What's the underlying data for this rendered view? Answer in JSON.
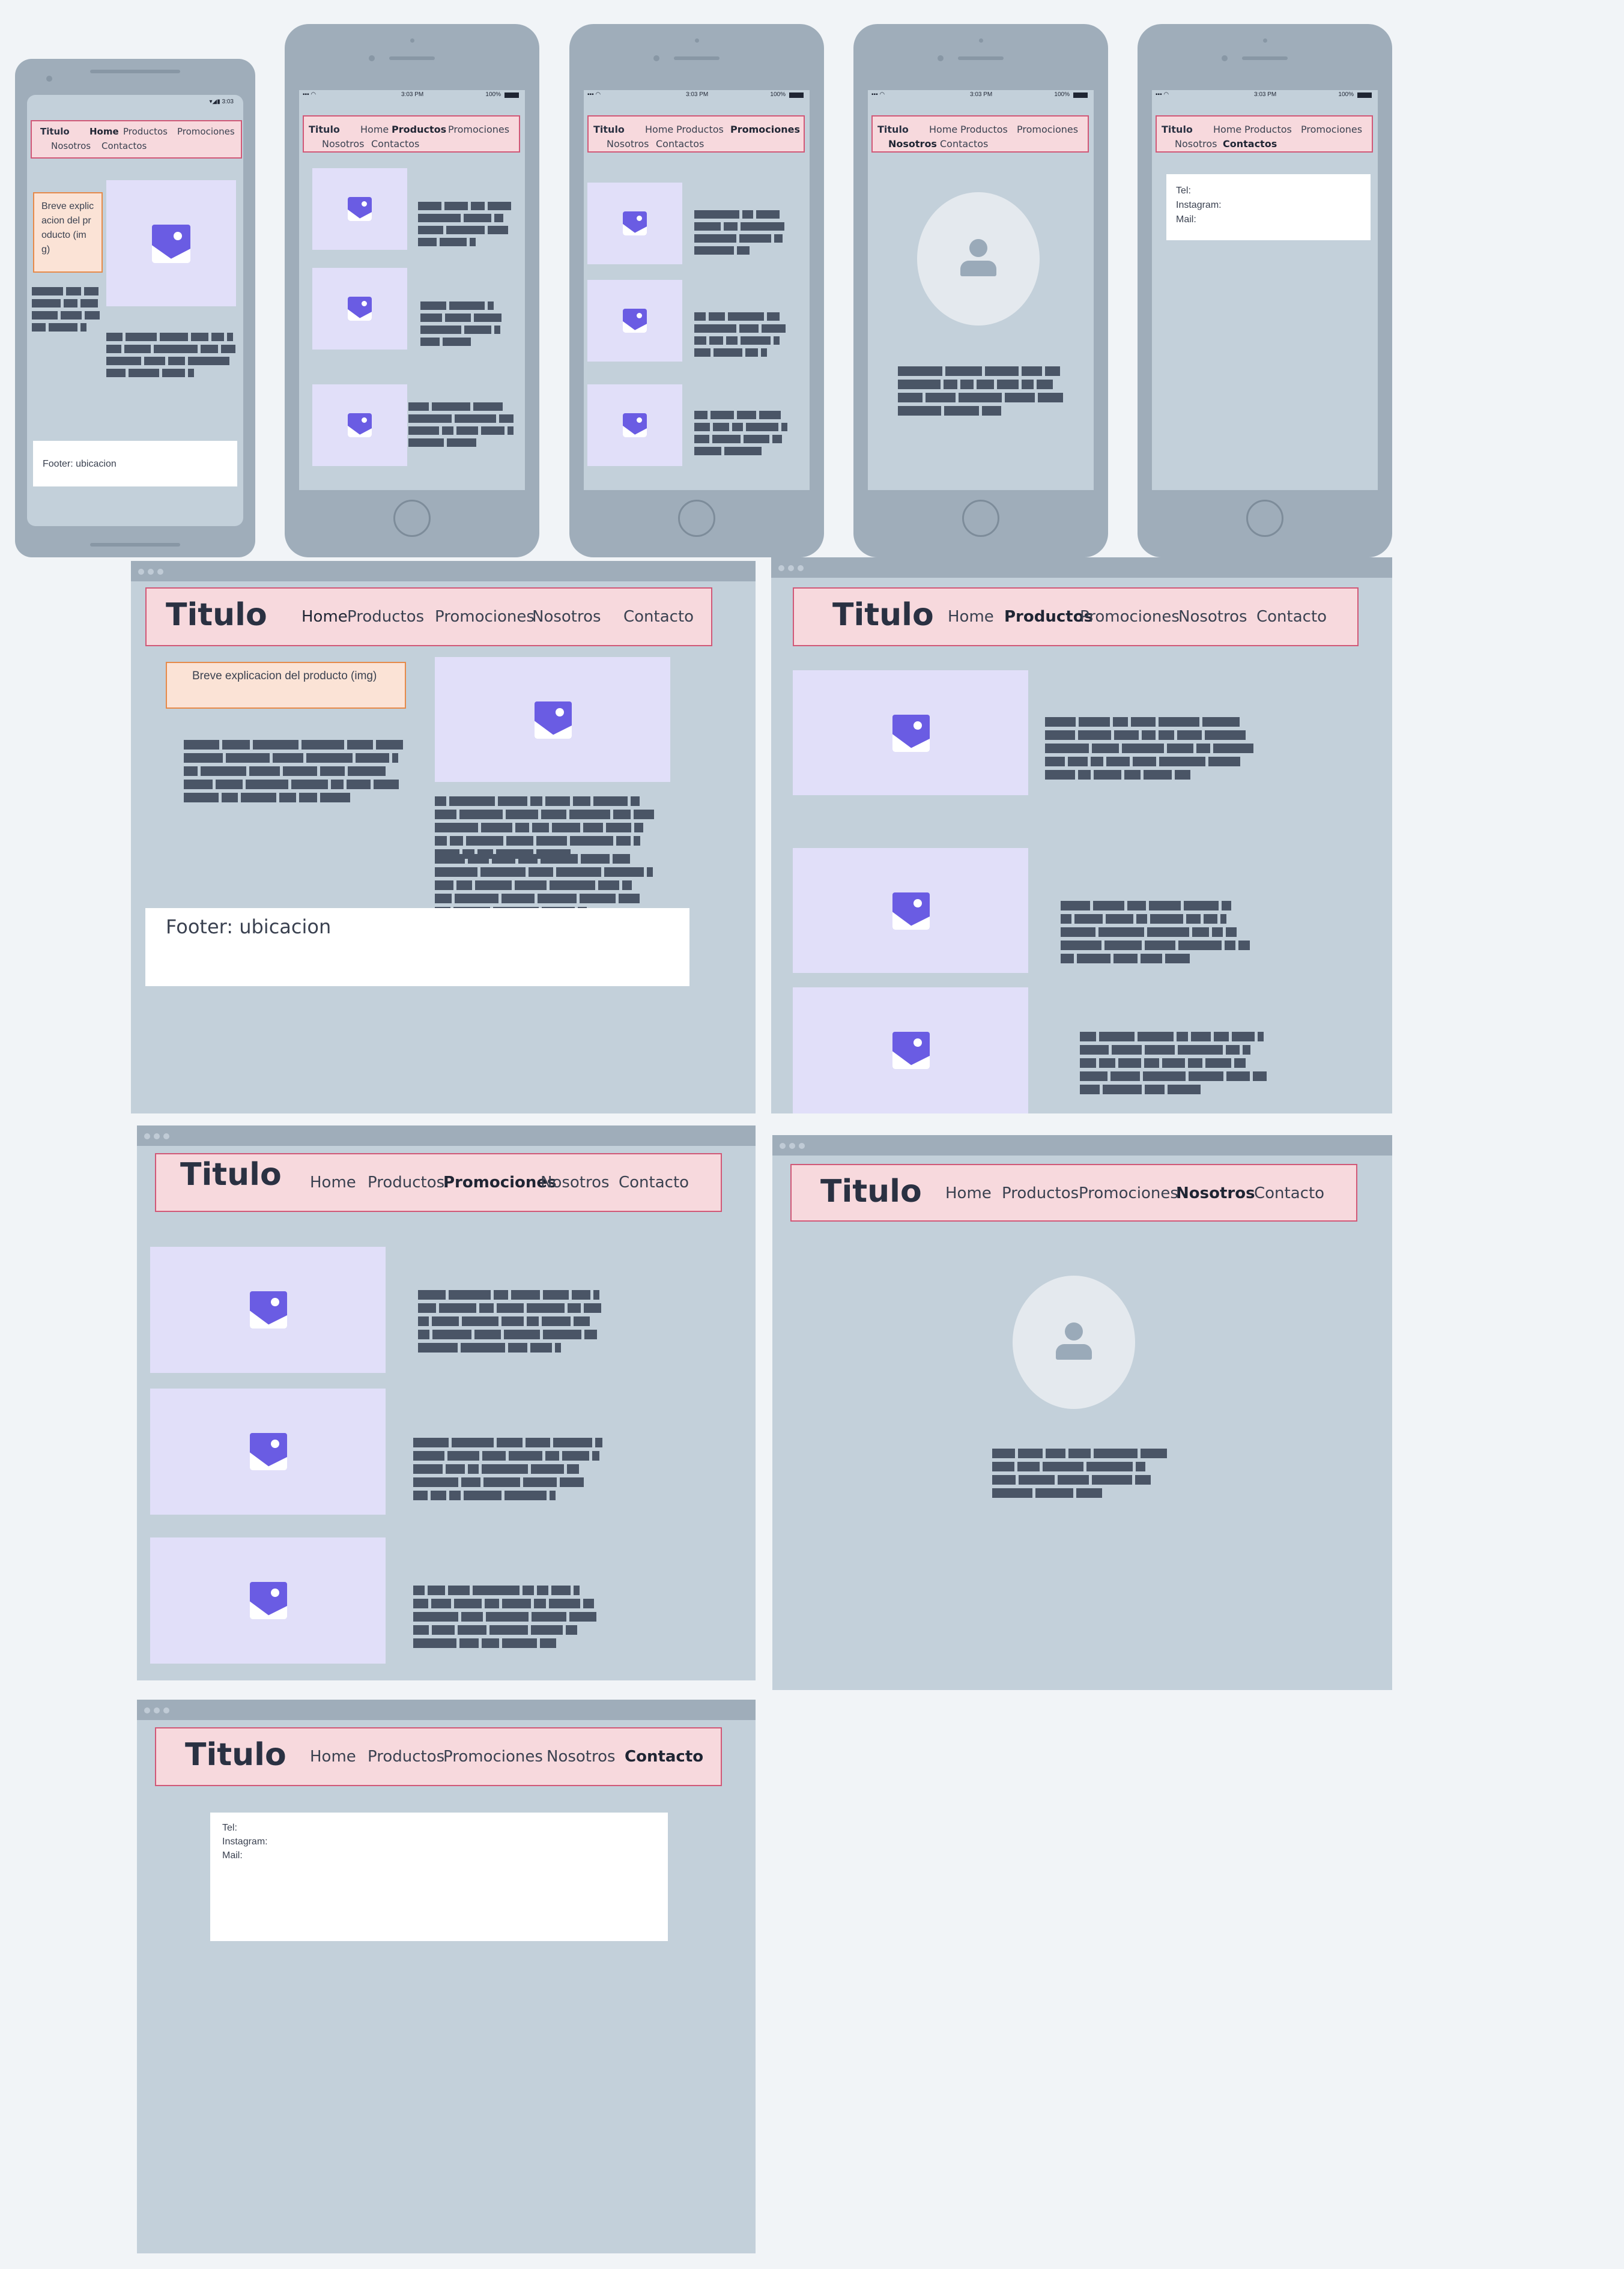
{
  "nav": {
    "title": "Titulo",
    "home": "Home",
    "productos": "Productos",
    "promociones": "Promociones",
    "nosotros": "Nosotros",
    "contacto": "Contacto",
    "contactos": "Contactos"
  },
  "status": {
    "android_time": "3:03",
    "ios_time": "3:03 PM",
    "battery": "100%"
  },
  "home_page": {
    "note": "Breve explicacion del producto (img)",
    "footer": "Footer: ubicacion"
  },
  "contact_page": {
    "tel": "Tel:",
    "instagram": "Instagram:",
    "mail": "Mail:"
  },
  "colors": {
    "canvas": "#f1f4f7",
    "device": "#9fadba",
    "screen": "#c3d0da",
    "nav_fill": "#f7d9dd",
    "nav_border": "#d15877",
    "image_placeholder": "#e1dff9",
    "image_icon": "#6a5ce3",
    "note_fill": "#fbe3d6",
    "note_border": "#e68a4a",
    "text_block": "#4a5566"
  }
}
